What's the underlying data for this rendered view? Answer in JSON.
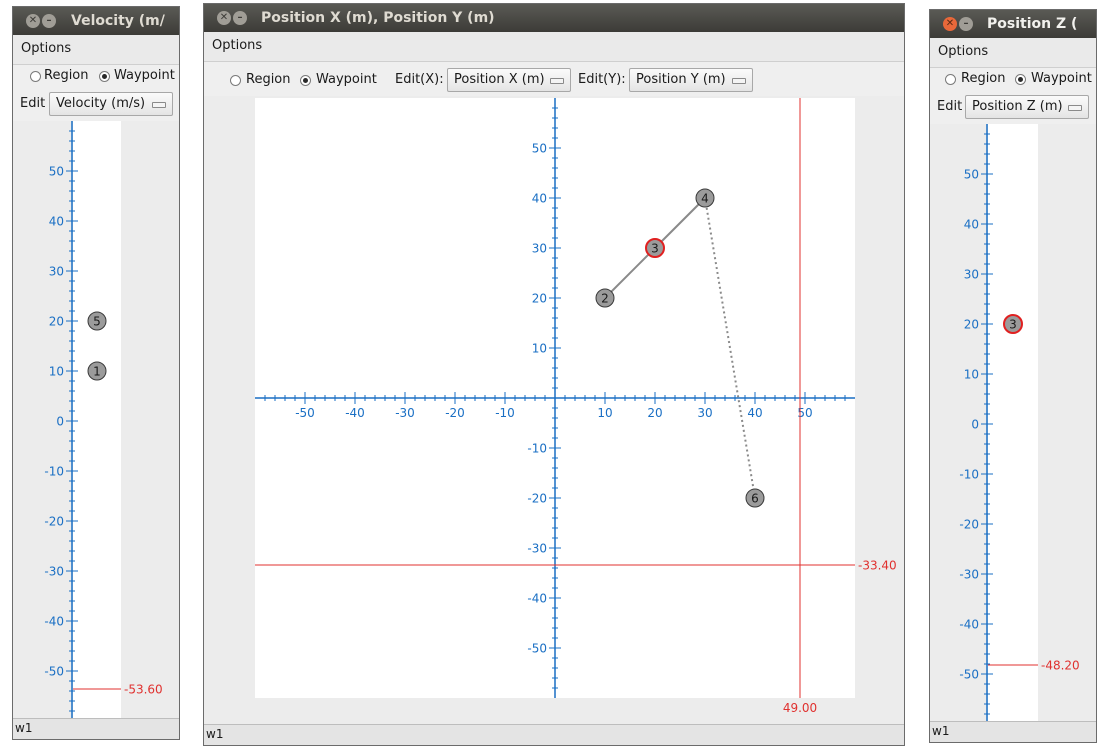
{
  "colors": {
    "axis": "#1a6fc4",
    "marker": "#e0312f",
    "point_fill": "#9b9b9b",
    "selected_ring": "#e02020"
  },
  "windows": {
    "velocity": {
      "title": "Velocity (m/",
      "menu": "Options",
      "radio_region": "Region",
      "radio_waypoint": "Waypoint",
      "edit_label": "Edit",
      "edit_value": "Velocity (m/s)",
      "marker_value": "-53.60",
      "status": "w1"
    },
    "position_xy": {
      "title": "Position X (m), Position Y (m)",
      "menu": "Options",
      "radio_region": "Region",
      "radio_waypoint": "Waypoint",
      "edit_x_label": "Edit(X):",
      "edit_x_value": "Position X (m)",
      "edit_y_label": "Edit(Y):",
      "edit_y_value": "Position Y (m)",
      "marker_x_value": "49.00",
      "marker_y_value": "-33.40",
      "status": "w1"
    },
    "position_z": {
      "title": "Position Z (",
      "menu": "Options",
      "radio_region": "Region",
      "radio_waypoint": "Waypoint",
      "edit_label": "Edit",
      "edit_value": "Position Z (m)",
      "marker_value": "-48.20",
      "status": "w1"
    }
  },
  "chart_data": [
    {
      "type": "scatter",
      "chart": "velocity",
      "ylim": [
        -60,
        60
      ],
      "y_ticks": [
        -50,
        -40,
        -30,
        -20,
        -10,
        0,
        10,
        20,
        30,
        40,
        50
      ],
      "points": [
        {
          "id": "5",
          "y": 20
        },
        {
          "id": "1",
          "y": 10
        }
      ],
      "marker": -53.6
    },
    {
      "type": "scatter",
      "chart": "position_xy",
      "xlim": [
        -60,
        60
      ],
      "ylim": [
        -60,
        60
      ],
      "x_ticks": [
        -50,
        -40,
        -30,
        -20,
        -10,
        10,
        20,
        30,
        40,
        50
      ],
      "y_ticks": [
        -50,
        -40,
        -30,
        -20,
        -10,
        10,
        20,
        30,
        40,
        50
      ],
      "points": [
        {
          "id": "2",
          "x": 10,
          "y": 20,
          "selected": false
        },
        {
          "id": "3",
          "x": 20,
          "y": 30,
          "selected": true
        },
        {
          "id": "4",
          "x": 30,
          "y": 40,
          "selected": false
        },
        {
          "id": "6",
          "x": 40,
          "y": -20,
          "selected": false
        }
      ],
      "path_solid": [
        "2",
        "3",
        "4"
      ],
      "path_dotted": [
        "4",
        "6"
      ],
      "marker_x": 49.0,
      "marker_y": -33.4
    },
    {
      "type": "scatter",
      "chart": "position_z",
      "ylim": [
        -60,
        60
      ],
      "y_ticks": [
        -50,
        -40,
        -30,
        -20,
        -10,
        0,
        10,
        20,
        30,
        40,
        50
      ],
      "points": [
        {
          "id": "3",
          "y": 20,
          "selected": true
        }
      ],
      "marker": -48.2
    }
  ]
}
